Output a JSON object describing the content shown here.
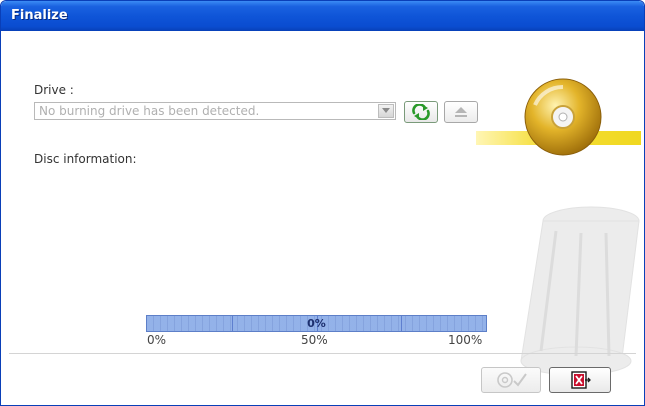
{
  "window": {
    "title": "Finalize"
  },
  "drive": {
    "label": "Drive :",
    "selected_value": "No burning drive has been detected.",
    "refresh_icon": "refresh-icon",
    "eject_icon": "eject-icon"
  },
  "disc_information": {
    "label": "Disc information:"
  },
  "progress": {
    "percent_label": "0%",
    "value": 0,
    "scale_min": "0%",
    "scale_mid": "50%",
    "scale_max": "100%"
  },
  "buttons": {
    "burn_icon": "disc-check-icon",
    "exit_icon": "exit-icon"
  },
  "colors": {
    "titlebar": "#0f55d8",
    "progress_fill": "#86a8e6",
    "accent_yellow": "#f0d820",
    "refresh_green": "#2a9a2a",
    "exit_red": "#c8102e"
  }
}
